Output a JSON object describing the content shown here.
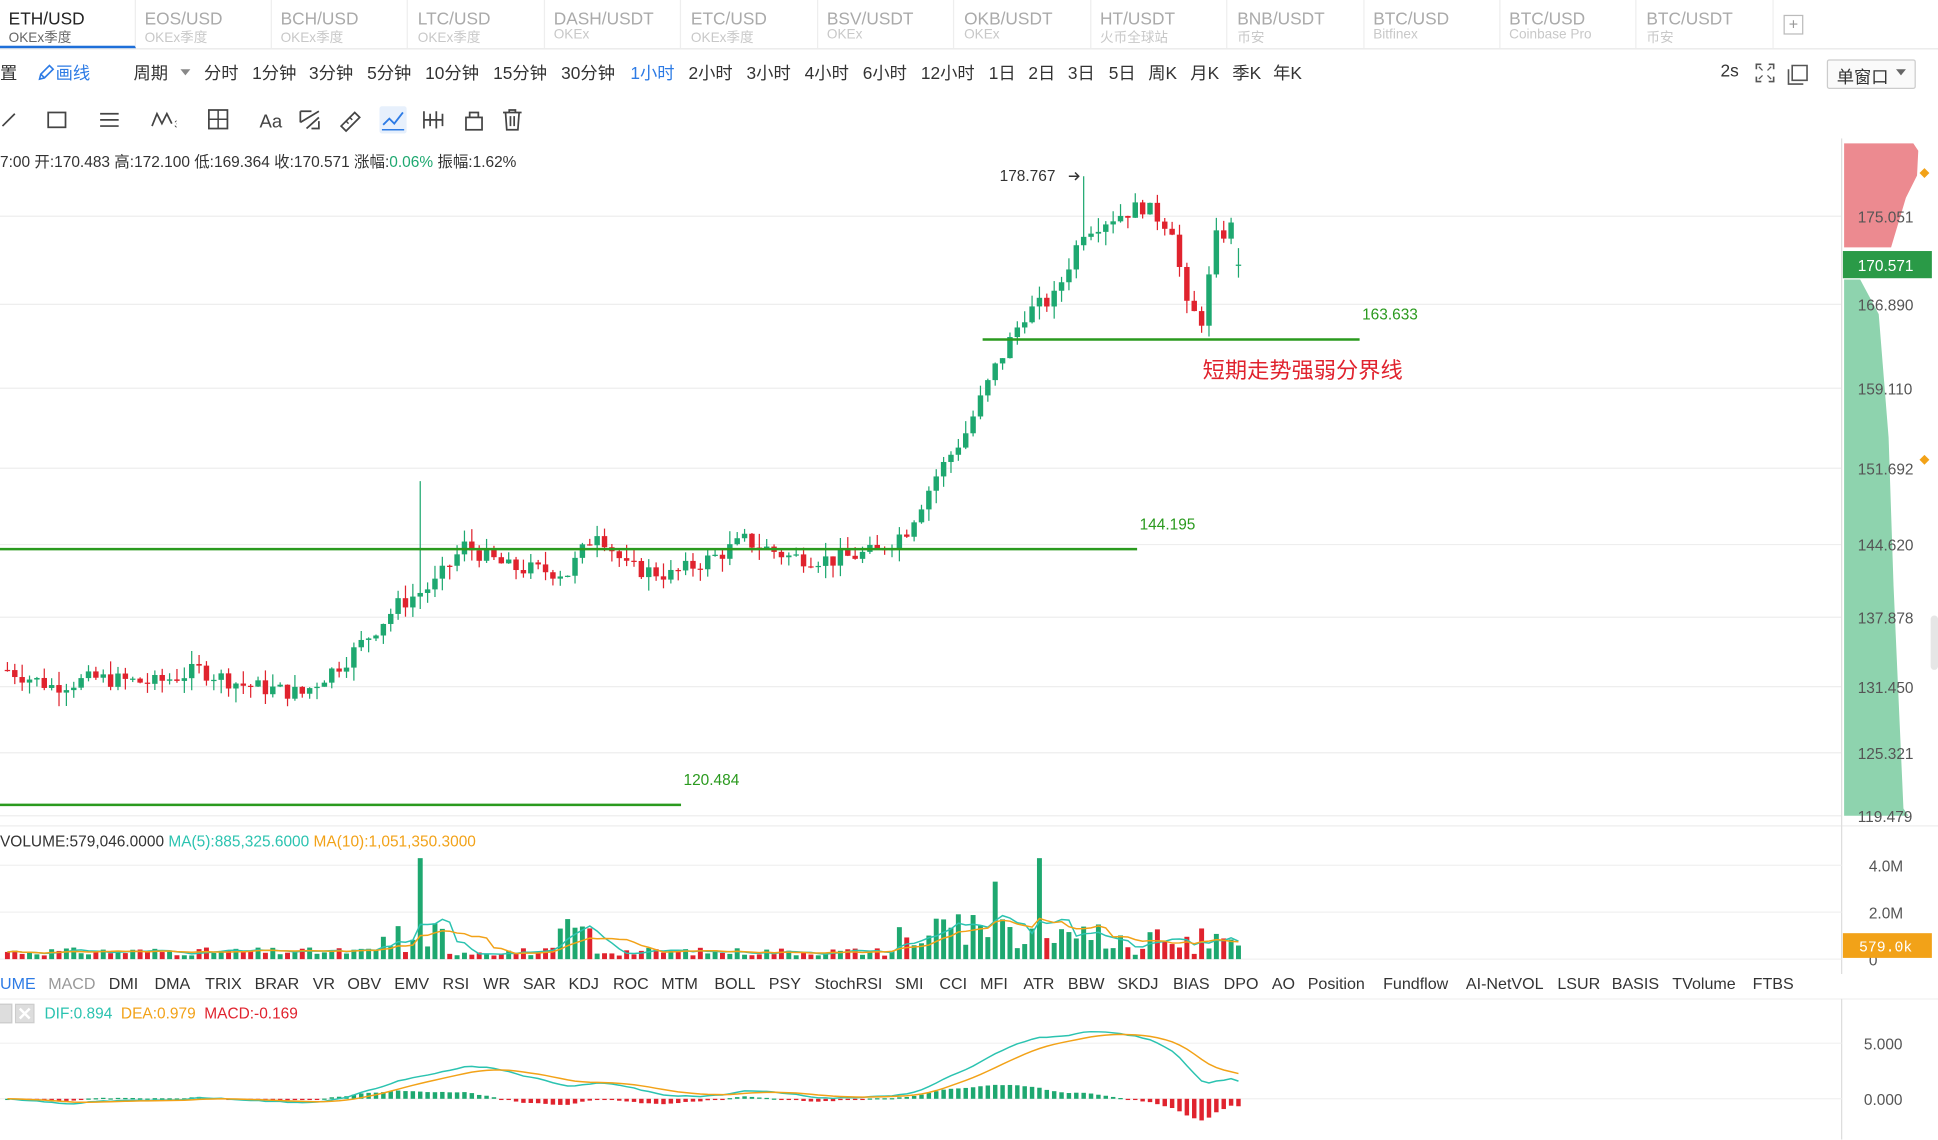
{
  "symbol_tabs": [
    {
      "symbol": "ETH/USD",
      "exchange": "OKEx季度",
      "active": true
    },
    {
      "symbol": "EOS/USD",
      "exchange": "OKEx季度"
    },
    {
      "symbol": "BCH/USD",
      "exchange": "OKEx季度"
    },
    {
      "symbol": "LTC/USD",
      "exchange": "OKEx季度"
    },
    {
      "symbol": "DASH/USDT",
      "exchange": "OKEx"
    },
    {
      "symbol": "ETC/USD",
      "exchange": "OKEx季度"
    },
    {
      "symbol": "BSV/USDT",
      "exchange": "OKEx"
    },
    {
      "symbol": "OKB/USDT",
      "exchange": "OKEx"
    },
    {
      "symbol": "HT/USDT",
      "exchange": "火币全球站"
    },
    {
      "symbol": "BNB/USDT",
      "exchange": "币安"
    },
    {
      "symbol": "BTC/USD",
      "exchange": "Bitfinex"
    },
    {
      "symbol": "BTC/USD",
      "exchange": "Coinbase Pro"
    },
    {
      "symbol": "BTC/USDT",
      "exchange": "币安"
    }
  ],
  "add_tab_label": "+",
  "period_bar": {
    "settings_partial": "置",
    "draw_label": "画线",
    "period_label": "周期",
    "periods": [
      "分时",
      "1分钟",
      "3分钟",
      "5分钟",
      "10分钟",
      "15分钟",
      "30分钟",
      "1小时",
      "2小时",
      "3小时",
      "4小时",
      "6小时",
      "12小时",
      "1日",
      "2日",
      "3日",
      "5日",
      "周K",
      "月K",
      "季K",
      "年K"
    ],
    "selected_period": "1小时",
    "refresh": "2s",
    "window_mode": "单窗口"
  },
  "ohlc_info": {
    "time": "7:00",
    "open_label": "开:",
    "open": "170.483",
    "high_label": "高:",
    "high": "172.100",
    "low_label": "低:",
    "low": "169.364",
    "close_label": "收:",
    "close": "170.571",
    "change_label": "涨幅:",
    "change": "0.06%",
    "amplitude_label": "振幅:",
    "amplitude": "1.62%"
  },
  "price_axis": {
    "ticks": [
      "175.051",
      "166.890",
      "159.110",
      "151.692",
      "144.620",
      "137.878",
      "131.450",
      "125.321",
      "119.479"
    ],
    "current_price": "170.571"
  },
  "annotations": {
    "high_marker": "178.767",
    "line_1": "163.633",
    "line_2": "144.195",
    "line_3": "120.484",
    "note": "短期走势强弱分界线"
  },
  "volume_info": {
    "label": "VOLUME:579,046.0000",
    "ma5": "MA(5):885,325.6000",
    "ma10": "MA(10):1,051,350.3000",
    "axis_ticks": [
      "4.0M",
      "2.0M",
      "0"
    ],
    "current": "579.0k"
  },
  "indicator_tabs": [
    "UME",
    "MACD",
    "DMI",
    "DMA",
    "TRIX",
    "BRAR",
    "VR",
    "OBV",
    "EMV",
    "RSI",
    "WR",
    "SAR",
    "KDJ",
    "ROC",
    "MTM",
    "BOLL",
    "PSY",
    "StochRSI",
    "SMI",
    "CCI",
    "MFI",
    "ATR",
    "BBW",
    "SKDJ",
    "BIAS",
    "DPO",
    "AO",
    "Position",
    "Fundflow",
    "AI-NetVOL",
    "LSUR",
    "BASIS",
    "TVolume",
    "FTBS"
  ],
  "macd_info": {
    "dif": "DIF:0.894",
    "dea": "DEA:0.979",
    "macd": "MACD:-0.169",
    "axis_ticks": [
      "5.000",
      "0.000"
    ]
  },
  "colors": {
    "up": "#1ea870",
    "down": "#e0232e",
    "line": "#2a9a1e",
    "accent": "#2d7be5",
    "ma5": "#2bc3b0",
    "ma10": "#f2a218",
    "dea": "#f2a218",
    "dif": "#2bc3b0"
  }
}
